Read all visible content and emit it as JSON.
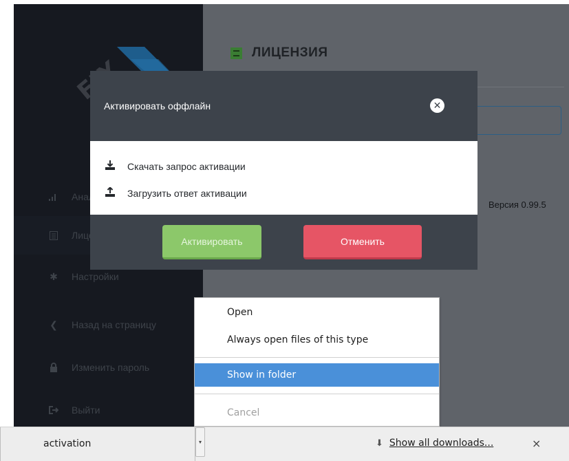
{
  "sidebar": {
    "logo_text": "FLY",
    "items": [
      {
        "label": "Аналитика",
        "icon": "bar-chart-icon"
      },
      {
        "label": "Лицензия",
        "icon": "list-icon"
      },
      {
        "label": "Настройки",
        "icon": "gear-icon"
      },
      {
        "label": "Назад на страницу",
        "icon": "chevron-left-icon"
      },
      {
        "label": "Изменить пароль",
        "icon": "lock-icon"
      },
      {
        "label": "Выйти",
        "icon": "sign-out-icon"
      }
    ]
  },
  "content": {
    "title": "ЛИЦЕНЗИЯ",
    "version": "Версия 0.99.5"
  },
  "modal": {
    "title": "Активировать оффлайн",
    "options": [
      {
        "label": "Скачать запрос активации",
        "icon": "download-icon"
      },
      {
        "label": "Загрузить ответ активации",
        "icon": "upload-icon"
      }
    ],
    "activate_label": "Активировать",
    "cancel_label": "Отменить"
  },
  "context_menu": {
    "items": [
      "Open",
      "Always open files of this type",
      "Show in folder",
      "Cancel"
    ]
  },
  "downloads": {
    "file_name": "activation",
    "show_all_label": "Show all downloads...",
    "close_label": "×"
  },
  "colors": {
    "sidebar_bg": "#161920",
    "overlay_bg": "#5f6369",
    "modal_header_bg": "#3d434b",
    "activate_green": "#8cc86a",
    "cancel_red": "#e65565",
    "menu_selected_blue": "#4a90d9"
  }
}
